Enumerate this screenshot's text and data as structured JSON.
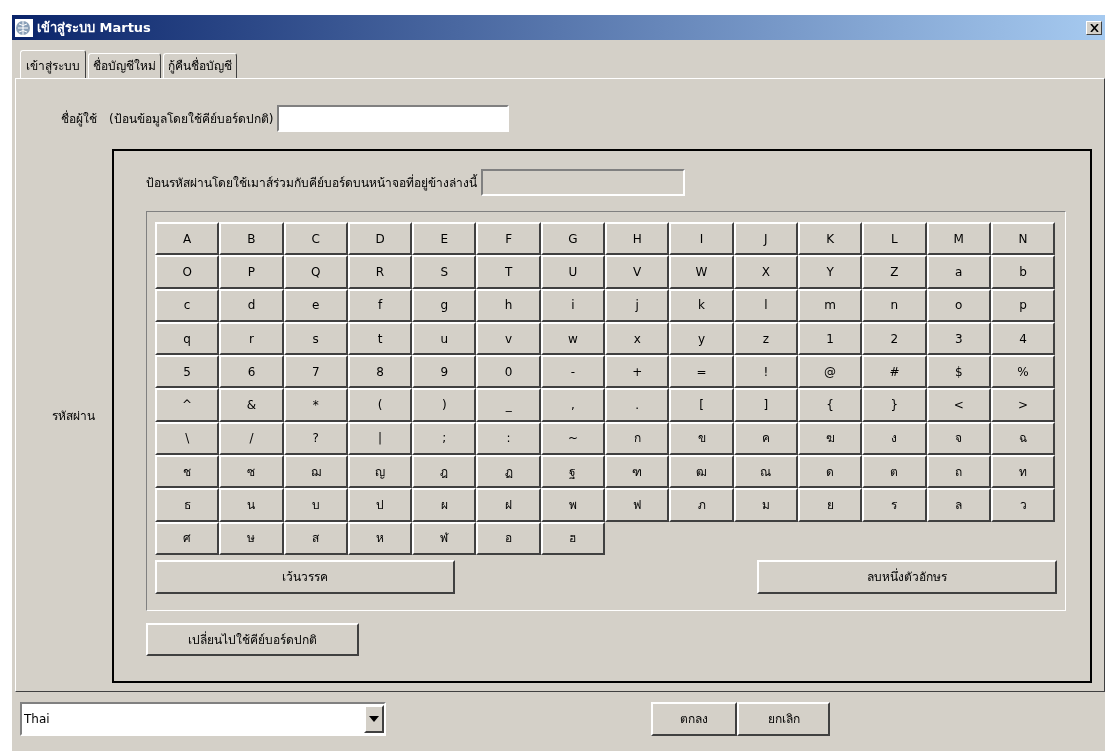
{
  "window": {
    "title": "เข้าสู่ระบบ Martus"
  },
  "tabs": [
    {
      "label": "เข้าสู่ระบบ",
      "selected": true
    },
    {
      "label": "ชื่อบัญชีใหม่",
      "selected": false
    },
    {
      "label": "กู้คืนชื่อบัญชี",
      "selected": false
    }
  ],
  "username": {
    "label": "ชื่อผู้ใช้",
    "hint": "(ป้อนข้อมูลโดยใช้คีย์บอร์ดปกติ)"
  },
  "password": {
    "label": "รหัสผ่าน",
    "instructions": "ป้อนรหัสผ่านโดยใช้เมาส์ร่วมกับคีย์บอร์ดบนหน้าจอที่อยู่ข้างล่างนี้"
  },
  "keyboard": {
    "rows": [
      [
        "A",
        "B",
        "C",
        "D",
        "E",
        "F",
        "G",
        "H",
        "I",
        "J",
        "K",
        "L",
        "M",
        "N"
      ],
      [
        "O",
        "P",
        "Q",
        "R",
        "S",
        "T",
        "U",
        "V",
        "W",
        "X",
        "Y",
        "Z",
        "a",
        "b"
      ],
      [
        "c",
        "d",
        "e",
        "f",
        "g",
        "h",
        "i",
        "j",
        "k",
        "l",
        "m",
        "n",
        "o",
        "p"
      ],
      [
        "q",
        "r",
        "s",
        "t",
        "u",
        "v",
        "w",
        "x",
        "y",
        "z",
        "1",
        "2",
        "3",
        "4"
      ],
      [
        "5",
        "6",
        "7",
        "8",
        "9",
        "0",
        "-",
        "+",
        "=",
        "!",
        "@",
        "#",
        "$",
        "%"
      ],
      [
        "^",
        "&",
        "*",
        "(",
        ")",
        "_",
        ",",
        ".",
        "[",
        "]",
        "{",
        "}",
        "<",
        ">"
      ],
      [
        "\\",
        "/",
        "?",
        "|",
        ";",
        ":",
        "~",
        "ก",
        "ข",
        "ค",
        "ฆ",
        "ง",
        "จ",
        "ฉ"
      ],
      [
        "ช",
        "ซ",
        "ฌ",
        "ญ",
        "ฎ",
        "ฏ",
        "ฐ",
        "ฑ",
        "ฒ",
        "ณ",
        "ด",
        "ต",
        "ถ",
        "ท"
      ],
      [
        "ธ",
        "น",
        "บ",
        "ป",
        "ผ",
        "ฝ",
        "พ",
        "ฟ",
        "ภ",
        "ม",
        "ย",
        "ร",
        "ล",
        "ว"
      ],
      [
        "ศ",
        "ษ",
        "ส",
        "ห",
        "ฬ",
        "อ",
        "ฮ"
      ]
    ],
    "space": "เว้นวรรค",
    "backspace": "ลบหนึ่งตัวอักษร"
  },
  "switch_keyboard": "เปลี่ยนไปใช้คีย์บอร์ดปกติ",
  "language": {
    "value": "Thai"
  },
  "buttons": [
    "ตกลง",
    "ยกเลิก"
  ]
}
